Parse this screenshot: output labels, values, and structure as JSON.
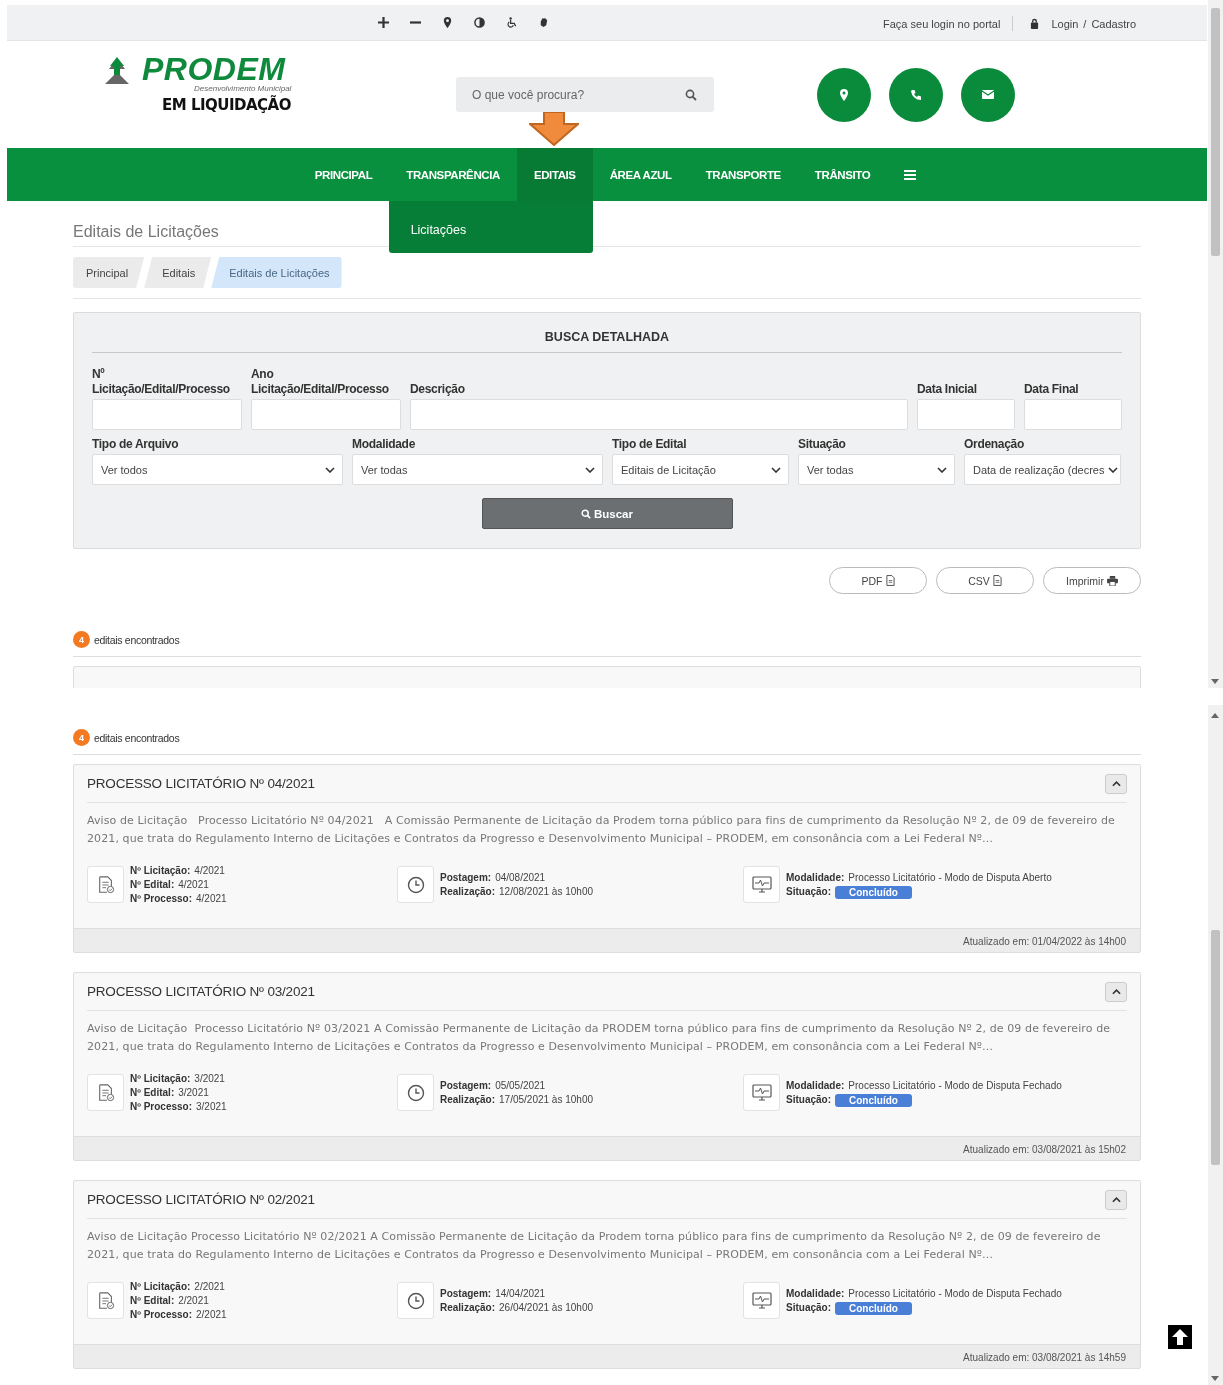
{
  "topbar": {
    "login_prompt": "Faça seu login no portal",
    "login": "Login",
    "separator": "/",
    "register": "Cadastro"
  },
  "logo": {
    "name": "PRODEM",
    "tagline": "Desenvolvimento Municipal",
    "status": "EM LIQUIDAÇÃO"
  },
  "search": {
    "placeholder": "O que você procura?"
  },
  "nav": {
    "items": [
      {
        "label": "PRINCIPAL",
        "selected": false
      },
      {
        "label": "TRANSPARÊNCIA",
        "selected": false
      },
      {
        "label": "EDITAIS",
        "selected": true
      },
      {
        "label": "ÁREA AZUL",
        "selected": false
      },
      {
        "label": "TRANSPORTE",
        "selected": false
      },
      {
        "label": "TRÂNSITO",
        "selected": false
      }
    ],
    "submenu": [
      "Licitações"
    ]
  },
  "page_title": "Editais de Licitações",
  "breadcrumb": [
    {
      "label": "Principal",
      "selected": false
    },
    {
      "label": "Editais",
      "selected": false
    },
    {
      "label": "Editais de Licitações",
      "selected": true
    }
  ],
  "filters": {
    "title": "BUSCA DETALHADA",
    "text_fields": [
      {
        "label": "Nº Licitação/Edital/Processo"
      },
      {
        "label": "Ano Licitação/Edital/Processo"
      },
      {
        "label": "Descrição"
      },
      {
        "label": "Data Inicial"
      },
      {
        "label": "Data Final"
      }
    ],
    "selects": [
      {
        "label": "Tipo de Arquivo",
        "value": "Ver todos"
      },
      {
        "label": "Modalidade",
        "value": "Ver todas"
      },
      {
        "label": "Tipo de Edital",
        "value": "Editais de Licitação"
      },
      {
        "label": "Situação",
        "value": "Ver todas"
      },
      {
        "label": "Ordenação",
        "value": "Data de realização (decres"
      }
    ],
    "submit": "Buscar"
  },
  "export_buttons": [
    {
      "label": "PDF",
      "kind": "pdf"
    },
    {
      "label": "CSV",
      "kind": "csv"
    },
    {
      "label": "Imprimir",
      "kind": "print"
    }
  ],
  "results_top": {
    "count": "4",
    "label": "editais encontrados"
  },
  "results_bottom": {
    "count": "4",
    "label": "editais encontrados"
  },
  "cards": [
    {
      "title": "PROCESSO LICITATÓRIO Nº 04/2021",
      "expanded": true,
      "description": "Aviso de Licitação   Processo Licitatório Nº 04/2021   A Comissão Permanente de Licitação da Prodem torna público para fins de cumprimento da Resolução Nº 2, de 09 de fevereiro de 2021, que trata do Regulamento Interno de Licitações e Contratos da Progresso e Desenvolvimento Municipal – PRODEM, em consonância com a Lei Federal Nº…",
      "numbers": [
        {
          "label": "Nº Licitação:",
          "value": "4/2021"
        },
        {
          "label": "Nº Edital:",
          "value": "4/2021"
        },
        {
          "label": "Nº Processo:",
          "value": "4/2021"
        }
      ],
      "dates": [
        {
          "label": "Postagem:",
          "value": "04/08/2021"
        },
        {
          "label": "Realização:",
          "value": "12/08/2021 às 10h00"
        }
      ],
      "modalidade": {
        "label": "Modalidade:",
        "value": "Processo Licitatório - Modo de Disputa Aberto"
      },
      "situacao": {
        "label": "Situação:",
        "value": "Concluído"
      },
      "updated": "Atualizado em: 01/04/2022 às 14h00"
    },
    {
      "title": "PROCESSO LICITATÓRIO Nº 03/2021",
      "expanded": true,
      "description": "Aviso de Licitação  Processo Licitatório Nº 03/2021 A Comissão Permanente de Licitação da PRODEM torna público para fins de cumprimento da Resolução Nº 2, de 09 de fevereiro de 2021, que trata do Regulamento Interno de Licitações e Contratos da Progresso e Desenvolvimento Municipal – PRODEM, em consonância com a Lei Federal Nº…",
      "numbers": [
        {
          "label": "Nº Licitação:",
          "value": "3/2021"
        },
        {
          "label": "Nº Edital:",
          "value": "3/2021"
        },
        {
          "label": "Nº Processo:",
          "value": "3/2021"
        }
      ],
      "dates": [
        {
          "label": "Postagem:",
          "value": "05/05/2021"
        },
        {
          "label": "Realização:",
          "value": "17/05/2021 às 10h00"
        }
      ],
      "modalidade": {
        "label": "Modalidade:",
        "value": "Processo Licitatório - Modo de Disputa Fechado"
      },
      "situacao": {
        "label": "Situação:",
        "value": "Concluído"
      },
      "updated": "Atualizado em: 03/08/2021 às 15h02"
    },
    {
      "title": "PROCESSO LICITATÓRIO Nº 02/2021",
      "expanded": true,
      "description": "Aviso de Licitação Processo Licitatório Nº 02/2021 A Comissão Permanente de Licitação da Prodem torna público para fins de cumprimento da Resolução Nº 2, de 09 de fevereiro de 2021, que trata do Regulamento Interno de Licitações e Contratos da Progresso e Desenvolvimento Municipal – PRODEM, em consonância com a Lei Federal Nº…",
      "numbers": [
        {
          "label": "Nº Licitação:",
          "value": "2/2021"
        },
        {
          "label": "Nº Edital:",
          "value": "2/2021"
        },
        {
          "label": "Nº Processo:",
          "value": "2/2021"
        }
      ],
      "dates": [
        {
          "label": "Postagem:",
          "value": "14/04/2021"
        },
        {
          "label": "Realização:",
          "value": "26/04/2021 às 10h00"
        }
      ],
      "modalidade": {
        "label": "Modalidade:",
        "value": "Processo Licitatório - Modo de Disputa Fechado"
      },
      "situacao": {
        "label": "Situação:",
        "value": "Concluído"
      },
      "updated": "Atualizado em: 03/08/2021 às 14h59"
    }
  ]
}
